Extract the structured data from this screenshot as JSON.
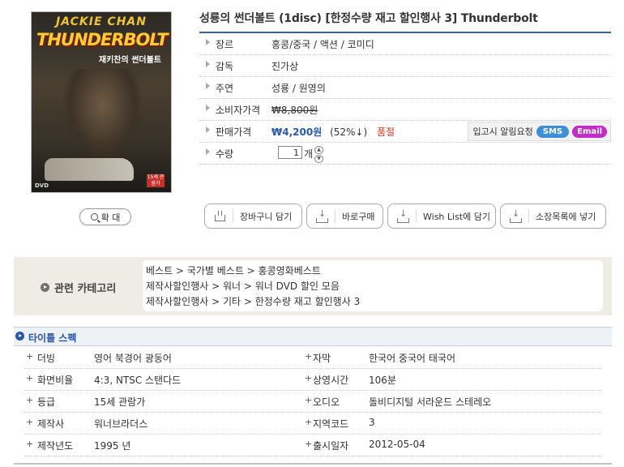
{
  "poster": {
    "actor_text": "JACKIE CHAN",
    "title_text": "THUNDERBOLT",
    "korean_title": "재키찬의 썬더볼트",
    "badge_text": "15세 관람가",
    "format_text": "DVD"
  },
  "zoom_label": "확 대",
  "product_title": "성룡의 썬더볼트 (1disc) [한정수량 재고 할인행사 3] Thunderbolt",
  "info": {
    "genre": {
      "label": "장르",
      "value": "홍콩/중국 / 액션 / 코미디"
    },
    "director": {
      "label": "감독",
      "value": "진가상"
    },
    "cast": {
      "label": "주연",
      "value": "성룡 / 원영의"
    },
    "retail_price": {
      "label": "소비자가격",
      "value": "₩8,800원"
    },
    "sale_price": {
      "label": "판매가격",
      "value": "₩4,200원",
      "discount": "(52%↓)",
      "status": "품절"
    },
    "notify": {
      "label": "입고시 알림요청",
      "sms": "SMS",
      "email": "Email"
    },
    "quantity": {
      "label": "수량",
      "value": "1",
      "unit": "개"
    }
  },
  "actions": {
    "cart": "장바구니 담기",
    "buy_now": "바로구매",
    "wishlist": "Wish List에 담기",
    "collection": "소장목록에 넣기"
  },
  "related": {
    "label": "관련 카테고리",
    "items": [
      "베스트 > 국가별 베스트 > 홍콩영화베스트",
      "제작사할인행사 > 워너 > 워너 DVD 할인 모음",
      "제작사할인행사 > 기타 > 한정수량 재고 할인행사 3"
    ]
  },
  "spec": {
    "title": "타이틀 스펙",
    "rows": [
      {
        "l_label": "더빙",
        "l_value": "영어 북경어 광동어",
        "r_label": "자막",
        "r_value": "한국어 중국어 태국어"
      },
      {
        "l_label": "화면비율",
        "l_value": "4:3, NTSC 스탠다드",
        "r_label": "상영시간",
        "r_value": "106분"
      },
      {
        "l_label": "등급",
        "l_value": "15세 관람가",
        "r_label": "오디오",
        "r_value": "돌비디지털 서라운드 스테레오"
      },
      {
        "l_label": "제작사",
        "l_value": "워너브라더스",
        "r_label": "지역코드",
        "r_value": "3"
      },
      {
        "l_label": "제작년도",
        "l_value": "1995 년",
        "r_label": "출시일자",
        "r_value": "2012-05-04"
      }
    ]
  },
  "colors": {
    "price_blue": "#2a58b3",
    "strike_orange": "#e07a1e",
    "soldout_red": "#d9341c",
    "sms_blue": "#3e8fd6",
    "email_purple": "#c12dc6",
    "spec_blue": "#2856a5"
  }
}
